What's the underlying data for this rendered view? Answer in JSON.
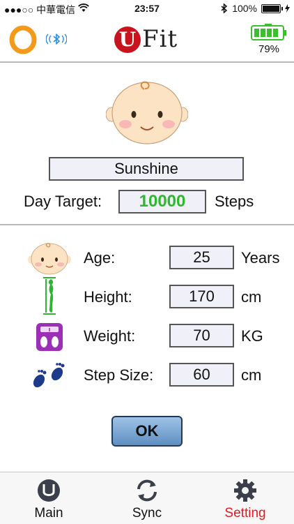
{
  "status_bar": {
    "carrier": "●●●○○ 中華電信",
    "time": "23:57",
    "battery": "100%"
  },
  "header": {
    "logo_u": "U",
    "logo_fit": "Fit",
    "device_battery": "79%"
  },
  "profile": {
    "name": "Sunshine",
    "day_target_label": "Day Target:",
    "day_target_value": "10000",
    "steps_label": "Steps",
    "target_color": "#2db82d"
  },
  "rows": [
    {
      "label": "Age:",
      "value": "25",
      "unit": "Years",
      "icon": "baby-face-icon"
    },
    {
      "label": "Height:",
      "value": "170",
      "unit": "cm",
      "icon": "height-body-icon"
    },
    {
      "label": "Weight:",
      "value": "70",
      "unit": "KG",
      "icon": "scale-icon"
    },
    {
      "label": "Step Size:",
      "value": "60",
      "unit": "cm",
      "icon": "footprints-icon"
    }
  ],
  "ok_label": "OK",
  "tabs": [
    {
      "label": "Main",
      "icon": "u-logo-icon",
      "active": false
    },
    {
      "label": "Sync",
      "icon": "sync-icon",
      "active": false
    },
    {
      "label": "Setting",
      "icon": "gear-icon",
      "active": true
    }
  ],
  "colors": {
    "brand_red": "#c8141e",
    "active_tab": "#e0191f",
    "battery_green": "#3bbf2e"
  }
}
